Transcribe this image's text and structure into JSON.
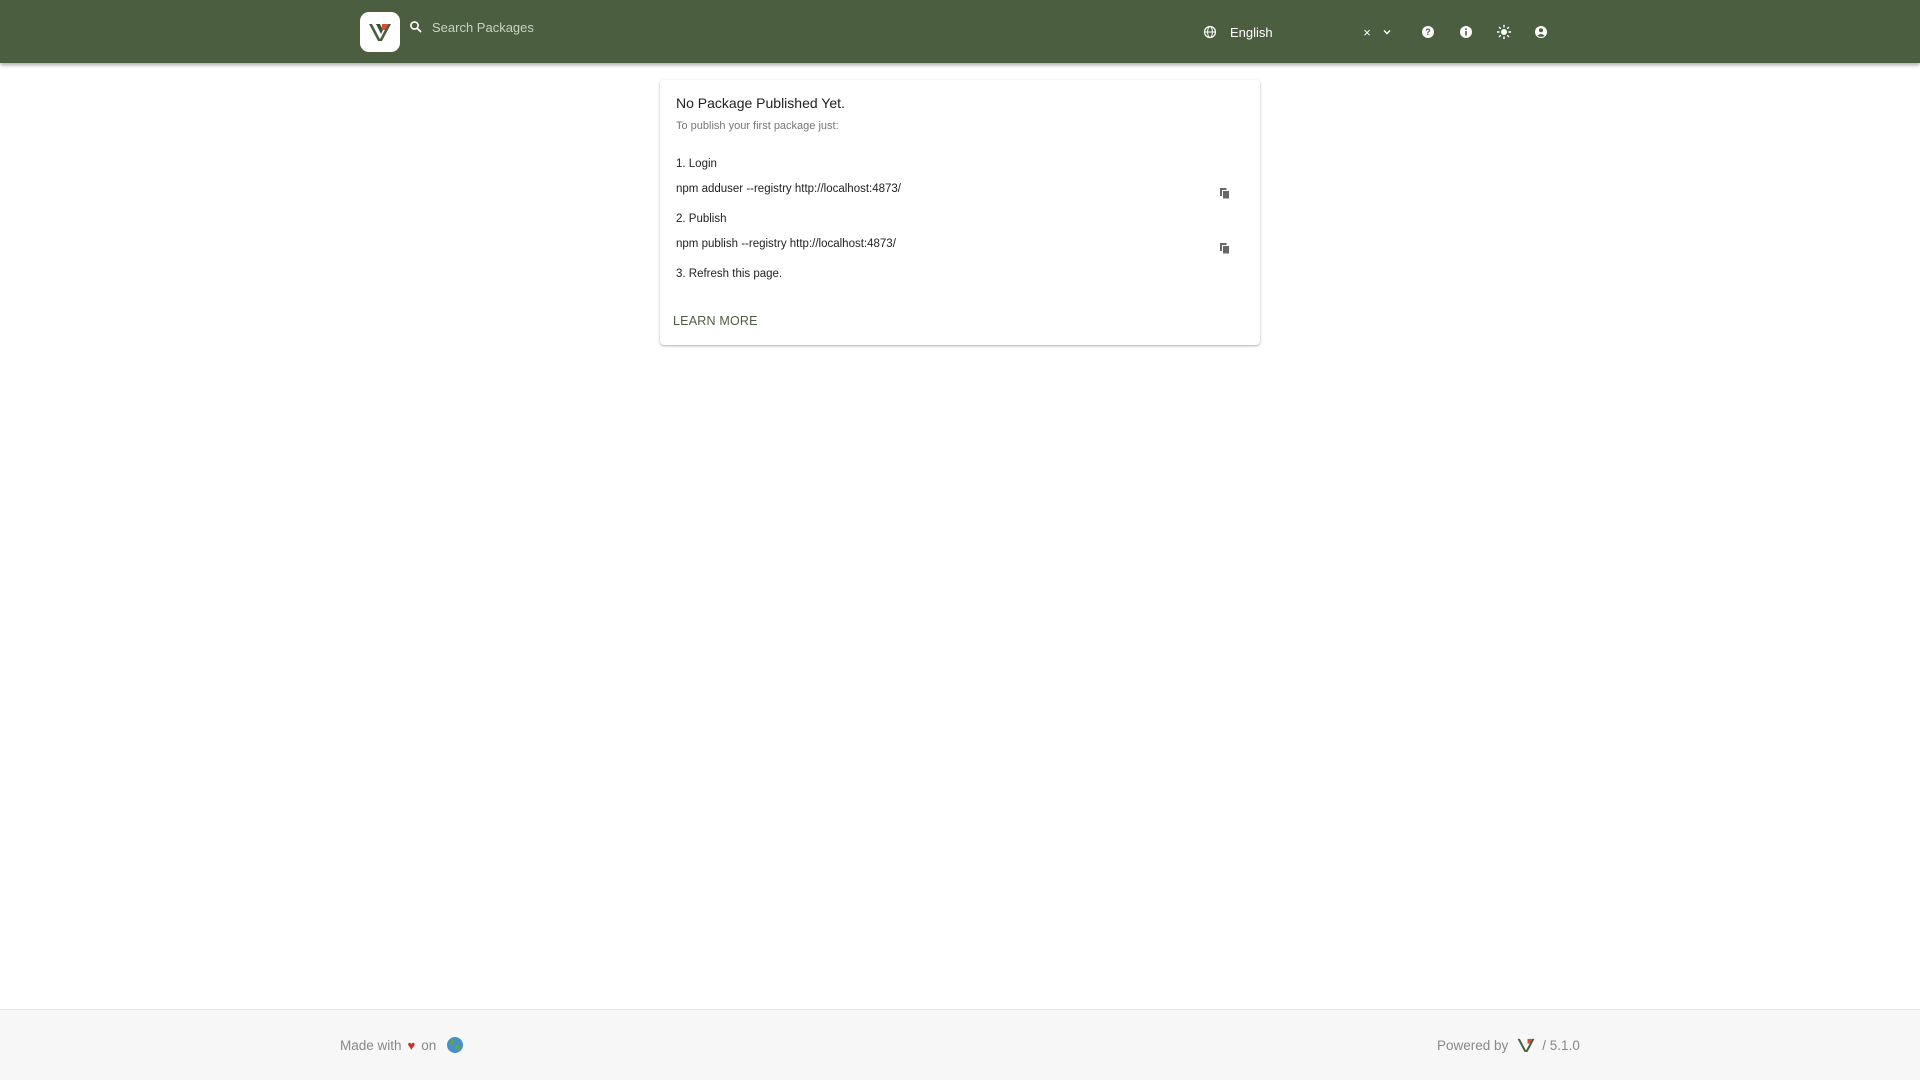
{
  "header": {
    "logo_name": "verdaccio-logo",
    "search_placeholder": "Search Packages",
    "language": {
      "selected": "English",
      "clear_label": "×"
    },
    "icons": [
      "help-icon",
      "info-icon",
      "theme-toggle-icon",
      "account-icon"
    ],
    "background": "#4b5e40"
  },
  "main": {
    "title": "No Package Published Yet.",
    "subtitle": "To publish your first package just:",
    "steps": [
      {
        "label": "1. Login",
        "command": "npm adduser --registry http://localhost:4873/"
      },
      {
        "label": "2. Publish",
        "command": "npm publish --registry http://localhost:4873/"
      },
      {
        "label": "3. Refresh this page."
      }
    ],
    "learn_more": "LEARN MORE"
  },
  "footer": {
    "made_with": "Made with",
    "on": "on",
    "powered_by": "Powered by",
    "version": "/ 5.1.0"
  },
  "colors": {
    "accent": "#4b5e40",
    "heart": "#d0302a"
  }
}
